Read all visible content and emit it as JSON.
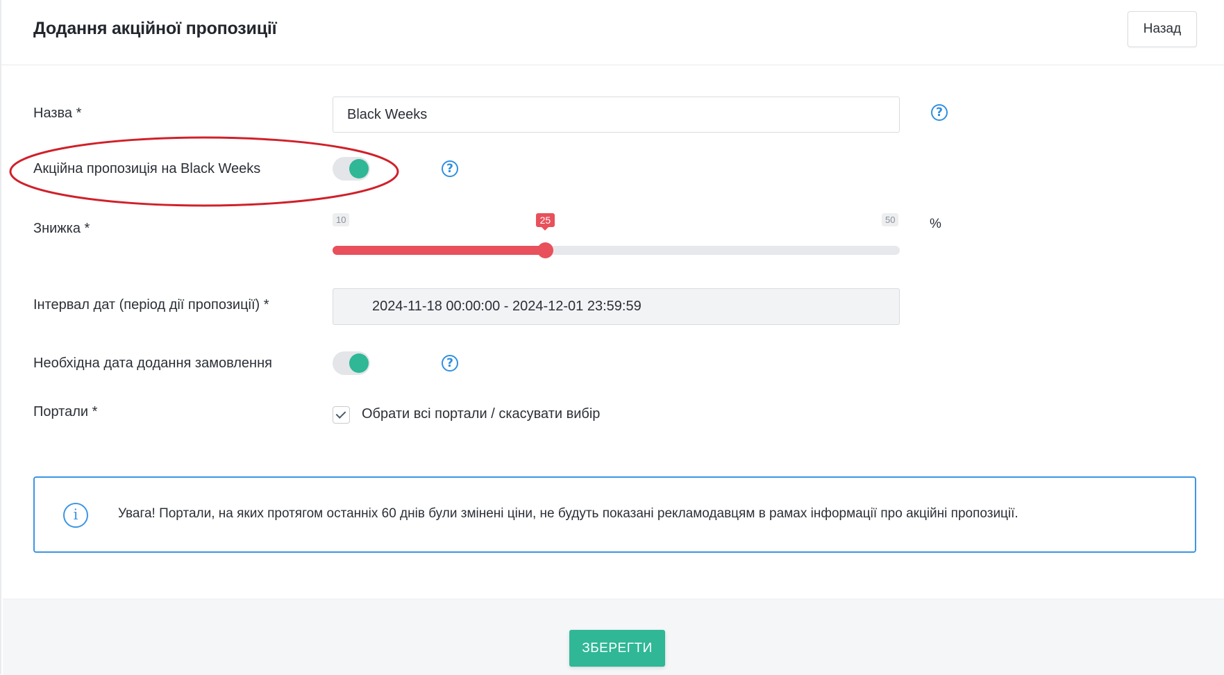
{
  "header": {
    "title": "Додання акційної пропозиції",
    "back_label": "Назад"
  },
  "form": {
    "name": {
      "label": "Назва *",
      "value": "Black Weeks"
    },
    "black_weeks": {
      "label": "Акційна пропозиція на Black Weeks",
      "enabled": true
    },
    "discount": {
      "label": "Знижка *",
      "min": "10",
      "max": "50",
      "value": "25",
      "unit": "%"
    },
    "date_range": {
      "label": "Інтервал дат (період дії пропозиції) *",
      "value": "2024-11-18 00:00:00 - 2024-12-01 23:59:59"
    },
    "order_date": {
      "label": "Необхідна дата додання замовлення",
      "enabled": true
    },
    "portals": {
      "label": "Портали *",
      "select_all_label": "Обрати всі портали / скасувати вибір",
      "checked": true
    }
  },
  "alert": {
    "text": "Увага! Портали, на яких протягом останніх 60 днів були змінені ціни, не будуть показані рекламодавцям в рамах інформації про акційні пропозиції."
  },
  "footer": {
    "save_label": "ЗБЕРЕГТИ"
  },
  "colors": {
    "accent_green": "#2fb796",
    "slider_red": "#e8505b",
    "info_blue": "#3c95e3",
    "annotation_red": "#d0202a"
  },
  "icons": {
    "help": "question-circle-icon",
    "info": "info-circle-icon",
    "check": "checkmark-icon"
  }
}
